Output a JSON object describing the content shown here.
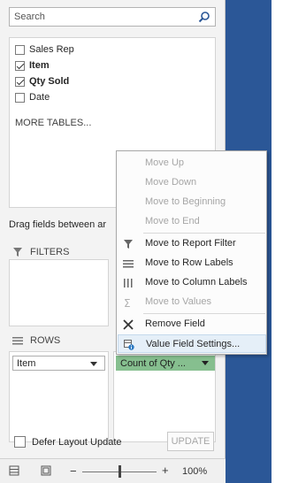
{
  "search": {
    "placeholder": "Search"
  },
  "fields": [
    {
      "label": "Sales Rep",
      "checked": false,
      "bold": false
    },
    {
      "label": "Item",
      "checked": true,
      "bold": true
    },
    {
      "label": "Qty Sold",
      "checked": true,
      "bold": true
    },
    {
      "label": "Date",
      "checked": false,
      "bold": false
    }
  ],
  "more_tables": "MORE TABLES...",
  "drag_text": "Drag fields between ar",
  "areas": {
    "filters_label": "FILTERS",
    "rows_label": "ROWS",
    "rows_item": "Item",
    "values_item": "Count of Qty ..."
  },
  "defer_label": "Defer Layout Update",
  "update_label": "UPDATE",
  "zoom": {
    "percent": "100%",
    "level": 0.5
  },
  "context_menu": {
    "items": [
      {
        "label": "Move Up",
        "disabled": true
      },
      {
        "label": "Move Down",
        "disabled": true
      },
      {
        "label": "Move to Beginning",
        "disabled": true
      },
      {
        "label": "Move to End",
        "disabled": true
      },
      {
        "label": "Move to Report Filter",
        "disabled": false
      },
      {
        "label": "Move to Row Labels",
        "disabled": false
      },
      {
        "label": "Move to Column Labels",
        "disabled": false
      },
      {
        "label": "Move to Values",
        "disabled": true
      },
      {
        "label": "Remove Field",
        "disabled": false
      },
      {
        "label": "Value Field Settings...",
        "disabled": false
      }
    ]
  },
  "colors": {
    "accent_blue": "#2b5797",
    "values_green": "#86bf8f",
    "pane_bg": "#f3f3f3"
  }
}
